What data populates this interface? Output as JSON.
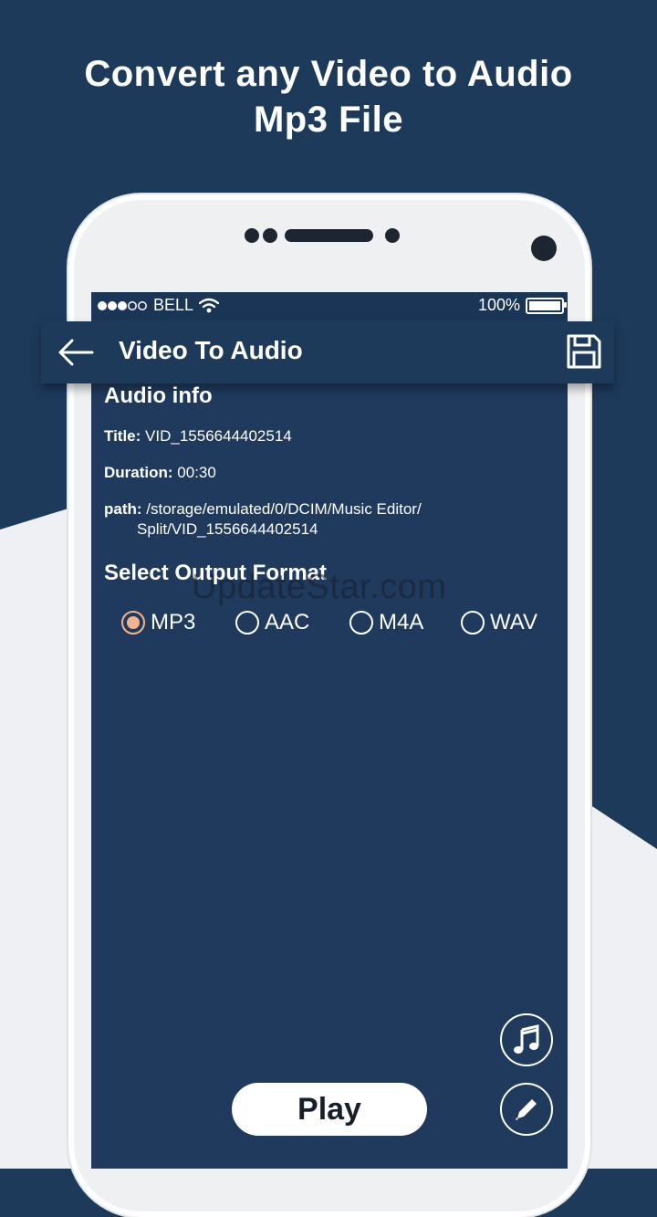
{
  "headline": {
    "line1": "Convert any Video to Audio",
    "line2": "Mp3 File"
  },
  "statusbar": {
    "carrier": "BELL",
    "battery": "100%",
    "signal_icon": "signal-dots-icon",
    "wifi_icon": "wifi-icon"
  },
  "appbar": {
    "title": "Video To Audio",
    "back_icon": "arrow-back-icon",
    "save_icon": "save-icon"
  },
  "audio_info": {
    "heading": "Audio info",
    "title_label": "Title:",
    "title_value": "VID_1556644402514",
    "duration_label": "Duration:",
    "duration_value": "00:30",
    "path_label": "path:",
    "path_value_line1": "/storage/emulated/0/DCIM/Music Editor/",
    "path_value_line2": "Split/VID_1556644402514"
  },
  "output": {
    "heading": "Select Output Format",
    "options": [
      "MP3",
      "AAC",
      "M4A",
      "WAV"
    ],
    "selected": "MP3"
  },
  "watermark": "UpdateStar.com",
  "actions": {
    "play_label": "Play",
    "music_icon": "music-note-icon",
    "edit_icon": "pencil-icon"
  },
  "colors": {
    "background": "#1d3a5b",
    "accent_radio": "#f2b48e",
    "phone_frame": "#eef0f2"
  }
}
